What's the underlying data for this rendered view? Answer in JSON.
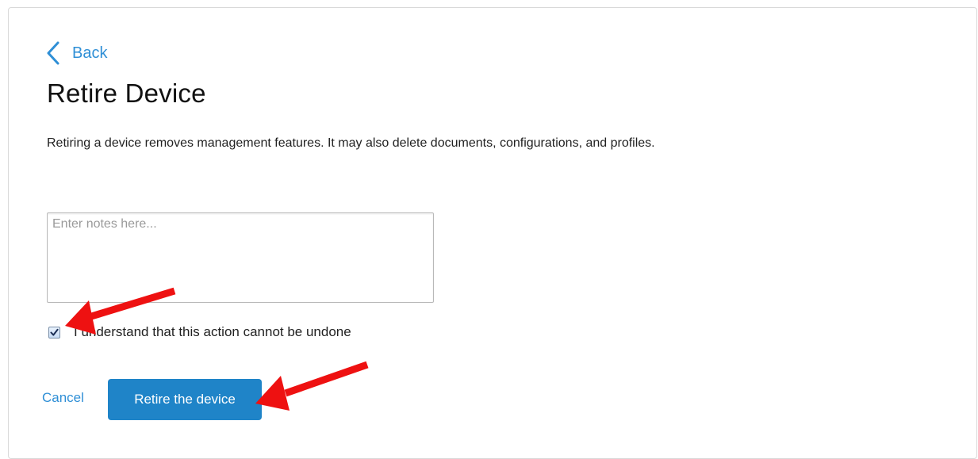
{
  "nav": {
    "back_label": "Back"
  },
  "page": {
    "title": "Retire Device",
    "description": "Retiring a device removes management features. It may also delete documents, configurations, and profiles."
  },
  "notes": {
    "placeholder": "Enter notes here...",
    "value": ""
  },
  "acknowledge": {
    "checked": true,
    "label": "I understand that this action cannot be undone"
  },
  "actions": {
    "cancel_label": "Cancel",
    "retire_label": "Retire the device"
  },
  "colors": {
    "link": "#2f8fd6",
    "primary_button": "#1f84c8",
    "annotation_arrow": "#ee1111"
  },
  "icons": {
    "back": "chevron-left-icon",
    "check": "checkmark-icon",
    "annotation": "red-arrow-icon"
  }
}
